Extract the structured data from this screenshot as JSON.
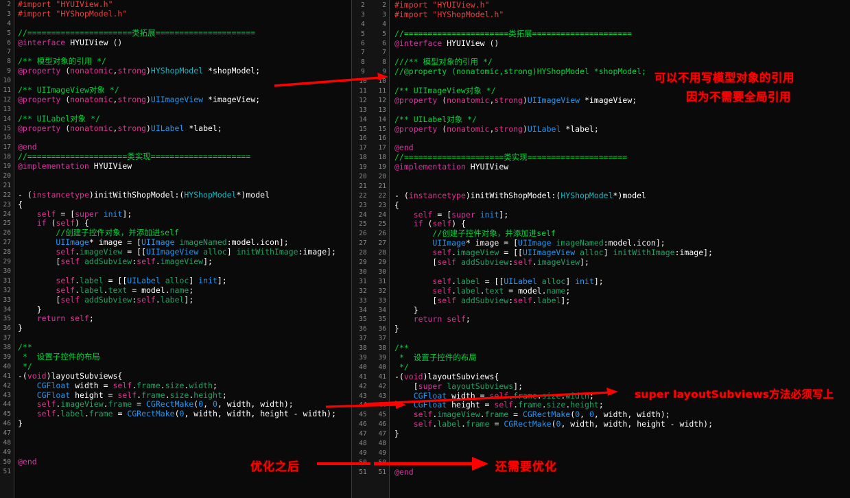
{
  "editor": {
    "theme_background": "#000000",
    "gutter_background": "#141414",
    "annotation_color": "#ff0000",
    "panes": [
      {
        "name": "left-pane",
        "first_line": 2,
        "last_line": 51,
        "lines": [
          {
            "n": 2,
            "html": "<span class='s-pre'>#import</span> <span class='s-str'>\"HYUIView.h\"</span>"
          },
          {
            "n": 3,
            "html": "<span class='s-pre'>#import</span> <span class='s-str'>\"HYShopModel.h\"</span>"
          },
          {
            "n": 4,
            "html": ""
          },
          {
            "n": 5,
            "html": "<span class='s-cmt'>//======================类拓展=====================</span>"
          },
          {
            "n": 6,
            "html": "<span class='s-key'>@interface</span> <span class='s-meth'>HYUIView</span> ()"
          },
          {
            "n": 7,
            "html": ""
          },
          {
            "n": 8,
            "html": "<span class='s-cmt'>/** 模型对象的引用 */</span>"
          },
          {
            "n": 9,
            "html": "<span class='s-key'>@property</span> (<span class='s-kw2'>nonatomic</span>,<span class='s-kw2'>strong</span>)<span class='s-type2'>HYShopModel</span> <span class='s-meth'>*shopModel;</span>"
          },
          {
            "n": 10,
            "html": ""
          },
          {
            "n": 11,
            "html": "<span class='s-cmt'>/** UIImageView对象 */</span>"
          },
          {
            "n": 12,
            "html": "<span class='s-key'>@property</span> (<span class='s-kw2'>nonatomic</span>,<span class='s-kw2'>strong</span>)<span class='s-type'>UIImageView</span> <span class='s-meth'>*imageView;</span>"
          },
          {
            "n": 13,
            "html": ""
          },
          {
            "n": 14,
            "html": "<span class='s-cmt'>/** UILabel对象 */</span>"
          },
          {
            "n": 15,
            "html": "<span class='s-key'>@property</span> (<span class='s-kw2'>nonatomic</span>,<span class='s-kw2'>strong</span>)<span class='s-type'>UILabel</span> <span class='s-meth'>*label;</span>"
          },
          {
            "n": 16,
            "html": ""
          },
          {
            "n": 17,
            "html": "<span class='s-key'>@end</span>"
          },
          {
            "n": 18,
            "html": "<span class='s-cmt'>//=====================类实现=====================</span>"
          },
          {
            "n": 19,
            "html": "<span class='s-key'>@implementation</span> <span class='s-meth'>HYUIView</span>"
          },
          {
            "n": 20,
            "html": ""
          },
          {
            "n": 21,
            "html": ""
          },
          {
            "n": 22,
            "html": "<span class='s-meth'>- (</span><span class='s-kw2'>instancetype</span><span class='s-meth'>)initWithShopModel:(</span><span class='s-type2'>HYShopModel</span><span class='s-meth'>*)model</span>"
          },
          {
            "n": 23,
            "html": "<span class='s-meth'>{</span>"
          },
          {
            "n": 24,
            "html": "    <span class='s-kw2'>self</span> <span class='s-meth'>= [</span><span class='s-key'>super</span> <span class='s-type'>init</span><span class='s-meth'>];</span>"
          },
          {
            "n": 25,
            "html": "    <span class='s-key'>if</span> <span class='s-meth'>(</span><span class='s-kw2'>self</span><span class='s-meth'>) {</span>"
          },
          {
            "n": 26,
            "html": "        <span class='s-cmt'>//创建子控件对象，并添加进self</span>"
          },
          {
            "n": 27,
            "html": "        <span class='s-type'>UIImage</span><span class='s-meth'>* image = [</span><span class='s-type'>UIImage</span> <span class='s-prop'>imageNamed</span><span class='s-meth'>:model.icon];</span>"
          },
          {
            "n": 28,
            "html": "        <span class='s-kw2'>self</span><span class='s-meth'>.</span><span class='s-prop'>imageView</span><span class='s-meth'> = [[</span><span class='s-type'>UIImageView</span> <span class='s-prop'>alloc</span><span class='s-meth'>] </span><span class='s-prop'>initWithImage</span><span class='s-meth'>:image];</span>"
          },
          {
            "n": 29,
            "html": "        <span class='s-meth'>[</span><span class='s-kw2'>self</span> <span class='s-prop'>addSubview</span><span class='s-meth'>:</span><span class='s-kw2'>self</span><span class='s-meth'>.</span><span class='s-prop'>imageView</span><span class='s-meth'>];</span>"
          },
          {
            "n": 30,
            "html": ""
          },
          {
            "n": 31,
            "html": "        <span class='s-kw2'>self</span><span class='s-meth'>.</span><span class='s-prop'>label</span><span class='s-meth'> = [[</span><span class='s-type'>UILabel</span> <span class='s-prop'>alloc</span><span class='s-meth'>] </span><span class='s-type'>init</span><span class='s-meth'>];</span>"
          },
          {
            "n": 32,
            "html": "        <span class='s-kw2'>self</span><span class='s-meth'>.</span><span class='s-prop'>label</span><span class='s-meth'>.</span><span class='s-prop'>text</span><span class='s-meth'> = model.</span><span class='s-prop'>name</span><span class='s-meth'>;</span>"
          },
          {
            "n": 33,
            "html": "        <span class='s-meth'>[</span><span class='s-kw2'>self</span> <span class='s-prop'>addSubview</span><span class='s-meth'>:</span><span class='s-kw2'>self</span><span class='s-meth'>.</span><span class='s-prop'>label</span><span class='s-meth'>];</span>"
          },
          {
            "n": 34,
            "html": "    <span class='s-meth'>}</span>"
          },
          {
            "n": 35,
            "html": "    <span class='s-key'>return</span> <span class='s-kw2'>self</span><span class='s-meth'>;</span>"
          },
          {
            "n": 36,
            "html": "<span class='s-meth'>}</span>"
          },
          {
            "n": 37,
            "html": ""
          },
          {
            "n": 38,
            "html": "<span class='s-cmt'>/**</span>"
          },
          {
            "n": 39,
            "html": " <span class='s-cmt'>*  设置子控件的布局</span>"
          },
          {
            "n": 40,
            "html": " <span class='s-cmt'>*/</span>"
          },
          {
            "n": 41,
            "html": "<span class='s-meth'>-(</span><span class='s-kw2'>void</span><span class='s-meth'>)layoutSubviews{</span>"
          },
          {
            "n": 42,
            "html": "    <span class='s-type'>CGFloat</span><span class='s-meth'> width = </span><span class='s-kw2'>self</span><span class='s-meth'>.</span><span class='s-prop'>frame</span><span class='s-meth'>.</span><span class='s-prop'>size</span><span class='s-meth'>.</span><span class='s-prop'>width</span><span class='s-meth'>;</span>"
          },
          {
            "n": 43,
            "html": "    <span class='s-type'>CGFloat</span><span class='s-meth'> height = </span><span class='s-kw2'>self</span><span class='s-meth'>.</span><span class='s-prop'>frame</span><span class='s-meth'>.</span><span class='s-prop'>size</span><span class='s-meth'>.</span><span class='s-prop'>height</span><span class='s-meth'>;</span>"
          },
          {
            "n": 44,
            "html": "    <span class='s-kw2'>self</span><span class='s-meth'>.</span><span class='s-prop'>imageView</span><span class='s-meth'>.</span><span class='s-prop'>frame</span><span class='s-meth'> = </span><span class='s-type'>CGRectMake</span><span class='s-meth'>(</span><span class='s-num'>0</span><span class='s-meth'>, </span><span class='s-num'>0</span><span class='s-meth'>, width, width);</span>"
          },
          {
            "n": 45,
            "html": "    <span class='s-kw2'>self</span><span class='s-meth'>.</span><span class='s-prop'>label</span><span class='s-meth'>.</span><span class='s-prop'>frame</span><span class='s-meth'> = </span><span class='s-type'>CGRectMake</span><span class='s-meth'>(</span><span class='s-num'>0</span><span class='s-meth'>, width, width, height - width);</span>"
          },
          {
            "n": 46,
            "html": "<span class='s-meth'>}</span>"
          },
          {
            "n": 47,
            "html": ""
          },
          {
            "n": 48,
            "html": ""
          },
          {
            "n": 49,
            "html": ""
          },
          {
            "n": 50,
            "html": "<span class='s-key'>@end</span>"
          },
          {
            "n": 51,
            "html": ""
          }
        ]
      },
      {
        "name": "right-pane",
        "first_line": 2,
        "last_line": 51,
        "lines": [
          {
            "n": 2,
            "html": "<span class='s-pre'>#import</span> <span class='s-str'>\"HYUIView.h\"</span>"
          },
          {
            "n": 3,
            "html": "<span class='s-pre'>#import</span> <span class='s-str'>\"HYShopModel.h\"</span>"
          },
          {
            "n": 4,
            "html": ""
          },
          {
            "n": 5,
            "html": "<span class='s-cmt'>//======================类拓展=====================</span>"
          },
          {
            "n": 6,
            "html": "<span class='s-key'>@interface</span> <span class='s-meth'>HYUIView</span> ()"
          },
          {
            "n": 7,
            "html": ""
          },
          {
            "n": 8,
            "html": "<span class='s-cmt'>///** 模型对象的引用 */</span>"
          },
          {
            "n": 9,
            "html": "<span class='s-cmt'>//@property (nonatomic,strong)HYShopModel *shopModel;</span>"
          },
          {
            "n": 10,
            "html": ""
          },
          {
            "n": 11,
            "html": "<span class='s-cmt'>/** UIImageView对象 */</span>"
          },
          {
            "n": 12,
            "html": "<span class='s-key'>@property</span> (<span class='s-kw2'>nonatomic</span>,<span class='s-kw2'>strong</span>)<span class='s-type'>UIImageView</span> <span class='s-meth'>*imageView;</span>"
          },
          {
            "n": 13,
            "html": ""
          },
          {
            "n": 14,
            "html": "<span class='s-cmt'>/** UILabel对象 */</span>"
          },
          {
            "n": 15,
            "html": "<span class='s-key'>@property</span> (<span class='s-kw2'>nonatomic</span>,<span class='s-kw2'>strong</span>)<span class='s-type'>UILabel</span> <span class='s-meth'>*label;</span>"
          },
          {
            "n": 16,
            "html": ""
          },
          {
            "n": 17,
            "html": "<span class='s-key'>@end</span>"
          },
          {
            "n": 18,
            "html": "<span class='s-cmt'>//=====================类实现=====================</span>"
          },
          {
            "n": 19,
            "html": "<span class='s-key'>@implementation</span> <span class='s-meth'>HYUIView</span>"
          },
          {
            "n": 20,
            "html": ""
          },
          {
            "n": 21,
            "html": ""
          },
          {
            "n": 22,
            "html": "<span class='s-meth'>- (</span><span class='s-kw2'>instancetype</span><span class='s-meth'>)initWithShopModel:(</span><span class='s-type2'>HYShopModel</span><span class='s-meth'>*)model</span>"
          },
          {
            "n": 23,
            "html": "<span class='s-meth'>{</span>"
          },
          {
            "n": 24,
            "html": "    <span class='s-kw2'>self</span> <span class='s-meth'>= [</span><span class='s-key'>super</span> <span class='s-type'>init</span><span class='s-meth'>];</span>"
          },
          {
            "n": 25,
            "html": "    <span class='s-key'>if</span> <span class='s-meth'>(</span><span class='s-kw2'>self</span><span class='s-meth'>) {</span>"
          },
          {
            "n": 26,
            "html": "        <span class='s-cmt'>//创建子控件对象，并添加进self</span>"
          },
          {
            "n": 27,
            "html": "        <span class='s-type'>UIImage</span><span class='s-meth'>* image = [</span><span class='s-type'>UIImage</span> <span class='s-prop'>imageNamed</span><span class='s-meth'>:model.icon];</span>"
          },
          {
            "n": 28,
            "html": "        <span class='s-kw2'>self</span><span class='s-meth'>.</span><span class='s-prop'>imageView</span><span class='s-meth'> = [[</span><span class='s-type'>UIImageView</span> <span class='s-prop'>alloc</span><span class='s-meth'>] </span><span class='s-prop'>initWithImage</span><span class='s-meth'>:image];</span>"
          },
          {
            "n": 29,
            "html": "        <span class='s-meth'>[</span><span class='s-kw2'>self</span> <span class='s-prop'>addSubview</span><span class='s-meth'>:</span><span class='s-kw2'>self</span><span class='s-meth'>.</span><span class='s-prop'>imageView</span><span class='s-meth'>];</span>"
          },
          {
            "n": 30,
            "html": ""
          },
          {
            "n": 31,
            "html": "        <span class='s-kw2'>self</span><span class='s-meth'>.</span><span class='s-prop'>label</span><span class='s-meth'> = [[</span><span class='s-type'>UILabel</span> <span class='s-prop'>alloc</span><span class='s-meth'>] </span><span class='s-type'>init</span><span class='s-meth'>];</span>"
          },
          {
            "n": 32,
            "html": "        <span class='s-kw2'>self</span><span class='s-meth'>.</span><span class='s-prop'>label</span><span class='s-meth'>.</span><span class='s-prop'>text</span><span class='s-meth'> = model.</span><span class='s-prop'>name</span><span class='s-meth'>;</span>"
          },
          {
            "n": 33,
            "html": "        <span class='s-meth'>[</span><span class='s-kw2'>self</span> <span class='s-prop'>addSubview</span><span class='s-meth'>:</span><span class='s-kw2'>self</span><span class='s-meth'>.</span><span class='s-prop'>label</span><span class='s-meth'>];</span>"
          },
          {
            "n": 34,
            "html": "    <span class='s-meth'>}</span>"
          },
          {
            "n": 35,
            "html": "    <span class='s-key'>return</span> <span class='s-kw2'>self</span><span class='s-meth'>;</span>"
          },
          {
            "n": 36,
            "html": "<span class='s-meth'>}</span>"
          },
          {
            "n": 37,
            "html": ""
          },
          {
            "n": 38,
            "html": "<span class='s-cmt'>/**</span>"
          },
          {
            "n": 39,
            "html": " <span class='s-cmt'>*  设置子控件的布局</span>"
          },
          {
            "n": 40,
            "html": " <span class='s-cmt'>*/</span>"
          },
          {
            "n": 41,
            "html": "<span class='s-meth'>-(</span><span class='s-kw2'>void</span><span class='s-meth'>)layoutSubviews{</span>"
          },
          {
            "n": 42,
            "html": "    <span class='s-meth'>[</span><span class='s-key'>super</span> <span class='s-prop'>layoutSubviews</span><span class='s-meth'>];</span>"
          },
          {
            "n": 43,
            "html": "    <span class='s-type'>CGFloat</span><span class='s-meth'> width = </span><span class='s-kw2'>self</span><span class='s-meth'>.</span><span class='s-prop'>frame</span><span class='s-meth'>.</span><span class='s-prop'>size</span><span class='s-meth'>.</span><span class='s-prop'>width</span><span class='s-meth'>;</span>"
          },
          {
            "n": 44,
            "html": "    <span class='s-type'>CGFloat</span><span class='s-meth'> height = </span><span class='s-kw2'>self</span><span class='s-meth'>.</span><span class='s-prop'>frame</span><span class='s-meth'>.</span><span class='s-prop'>size</span><span class='s-meth'>.</span><span class='s-prop'>height</span><span class='s-meth'>;</span>"
          },
          {
            "n": 45,
            "html": "    <span class='s-kw2'>self</span><span class='s-meth'>.</span><span class='s-prop'>imageView</span><span class='s-meth'>.</span><span class='s-prop'>frame</span><span class='s-meth'> = </span><span class='s-type'>CGRectMake</span><span class='s-meth'>(</span><span class='s-num'>0</span><span class='s-meth'>, </span><span class='s-num'>0</span><span class='s-meth'>, width, width);</span>"
          },
          {
            "n": 46,
            "html": "    <span class='s-kw2'>self</span><span class='s-meth'>.</span><span class='s-prop'>label</span><span class='s-meth'>.</span><span class='s-prop'>frame</span><span class='s-meth'> = </span><span class='s-type'>CGRectMake</span><span class='s-meth'>(</span><span class='s-num'>0</span><span class='s-meth'>, width, width, height - width);</span>"
          },
          {
            "n": 47,
            "html": "<span class='s-meth'>}</span>"
          },
          {
            "n": 48,
            "html": ""
          },
          {
            "n": 49,
            "html": ""
          },
          {
            "n": 50,
            "html": ""
          },
          {
            "n": 51,
            "html": "<span class='s-key'>@end</span>"
          }
        ]
      }
    ]
  },
  "annotations": [
    {
      "name": "annotation-no-model-ref",
      "text": "可以不用写模型对象的引用"
    },
    {
      "name": "annotation-no-global-ref",
      "text": "因为不需要全局引用"
    },
    {
      "name": "annotation-super-layoutsubviews",
      "text": "super layoutSubviews方法必须写上"
    },
    {
      "name": "annotation-after-optimization",
      "text": "优化之后"
    },
    {
      "name": "annotation-needs-optimization",
      "text": "还需要优化"
    }
  ]
}
